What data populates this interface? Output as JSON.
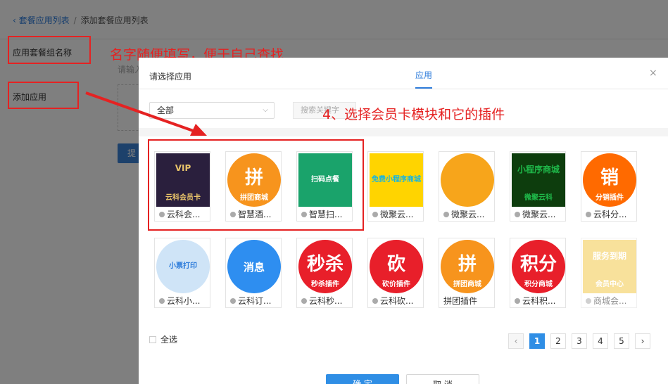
{
  "breadcrumb": {
    "back": "‹ 套餐应用列表",
    "sep": "/",
    "current": "添加套餐应用列表"
  },
  "form": {
    "name_label": "应用套餐组名称",
    "add_label": "添加应用",
    "input_hint": "请输入",
    "submit_label": "提"
  },
  "annotations": {
    "name_note": "名字随便填写，便于自己查找",
    "step_note": "4、选择会员卡模块和它的插件",
    "colors": {
      "red": "#e52222"
    }
  },
  "modal": {
    "title": "请选择应用",
    "tab": "应用",
    "close": "×",
    "select_value": "全部",
    "search_placeholder": "搜索关键字",
    "check_all": "全选",
    "confirm": "确 定",
    "cancel": "取 消",
    "pages": [
      "1",
      "2",
      "3",
      "4",
      "5"
    ],
    "active_page": "1",
    "prev": "‹",
    "next": "›"
  },
  "apps": [
    {
      "caption": "云科会...",
      "thumb_text": [
        "VIP",
        "云科会员卡"
      ],
      "color": "#2a1f3d",
      "accent": "#e9c46a"
    },
    {
      "caption": "智慧酒...",
      "thumb_text": [
        "拼",
        "拼团商城"
      ],
      "color": "#f7941d",
      "accent": "#ffffff"
    },
    {
      "caption": "智慧扫...",
      "thumb_text": [
        "扫码点餐"
      ],
      "color": "#1aa36b",
      "accent": "#ffffff"
    },
    {
      "caption": "微聚云...",
      "thumb_text": [
        "免费小程序商城"
      ],
      "color": "#ffd400",
      "accent": "#16b5e0"
    },
    {
      "caption": "微聚云...",
      "thumb_text": [],
      "color": "#f7a51b",
      "accent": "#ffffff"
    },
    {
      "caption": "微聚云...",
      "thumb_text": [
        "小程序商城",
        "微聚云科"
      ],
      "color": "#0d3d0d",
      "accent": "#1fb94a"
    },
    {
      "caption": "云科分...",
      "thumb_text": [
        "销",
        "分销插件"
      ],
      "color": "#ff6a00",
      "accent": "#ffffff"
    },
    {
      "caption": "云科小...",
      "thumb_text": [
        "小票打印"
      ],
      "color": "#cfe4f7",
      "accent": "#2f7ddb"
    },
    {
      "caption": "云科订...",
      "thumb_text": [
        "消息"
      ],
      "color": "#2e8ef0",
      "accent": "#ffffff"
    },
    {
      "caption": "云科秒...",
      "thumb_text": [
        "秒杀",
        "秒杀插件"
      ],
      "color": "#e81f2a",
      "accent": "#ffffff"
    },
    {
      "caption": "云科砍...",
      "thumb_text": [
        "砍",
        "砍价插件"
      ],
      "color": "#e81f2a",
      "accent": "#ffffff"
    },
    {
      "caption": "拼团插件",
      "thumb_text": [
        "拼",
        "拼团商城"
      ],
      "color": "#f7941d",
      "accent": "#ffffff"
    },
    {
      "caption": "云科积...",
      "thumb_text": [
        "积分",
        "积分商城"
      ],
      "color": "#e81f2a",
      "accent": "#ffffff"
    },
    {
      "caption": "商城会...",
      "thumb_text": [
        "服务到期",
        "会员中心"
      ],
      "color": "#f3c94a",
      "accent": "#ffffff"
    }
  ]
}
